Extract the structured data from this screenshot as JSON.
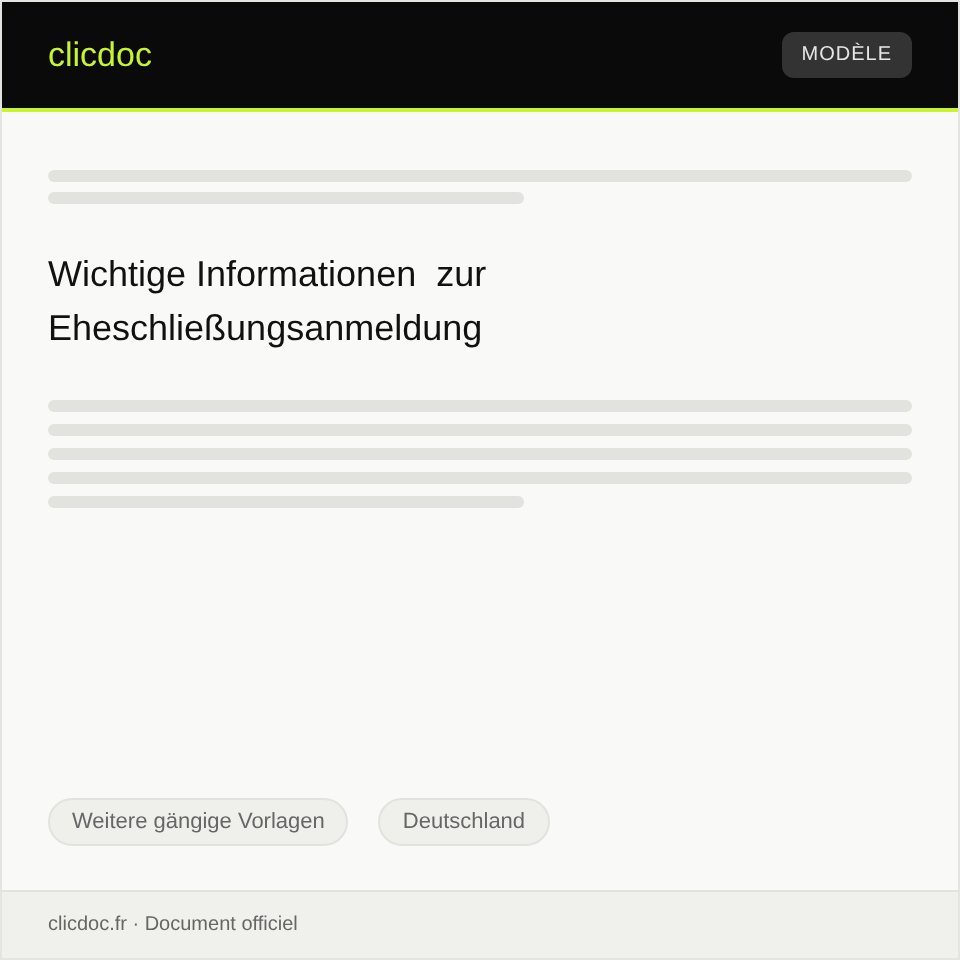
{
  "header": {
    "logo": "clicdoc",
    "badge": "MODÈLE"
  },
  "title": "Wichtige Informationen  zur Eheschließungsanmeldung",
  "tags": [
    "Weitere gängige Vorlagen",
    "Deutschland"
  ],
  "footer": "clicdoc.fr · Document officiel"
}
